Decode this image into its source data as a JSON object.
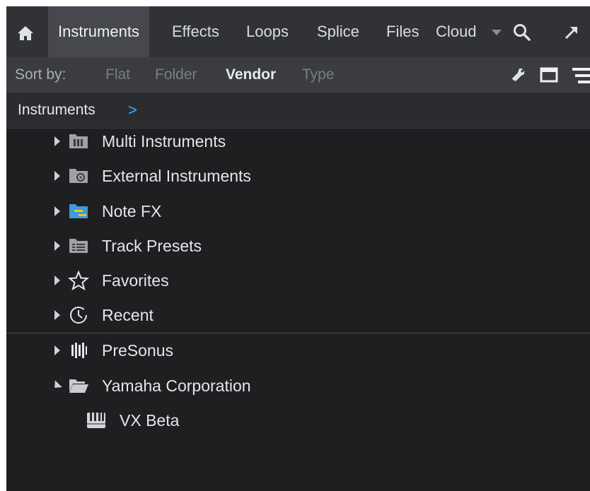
{
  "tabs": {
    "items": [
      {
        "label": "Instruments",
        "active": true
      },
      {
        "label": "Effects"
      },
      {
        "label": "Loops"
      },
      {
        "label": "Splice"
      },
      {
        "label": "Files"
      }
    ],
    "cloud_label": "Cloud"
  },
  "sort": {
    "label": "Sort by:",
    "options": [
      "Flat",
      "Folder",
      "Vendor",
      "Type"
    ],
    "selected": "Vendor"
  },
  "breadcrumb": {
    "label": "Instruments",
    "arrow": ">"
  },
  "tree": {
    "items": [
      {
        "label": "Multi Instruments",
        "icon": "multi-instruments-folder-icon"
      },
      {
        "label": "External Instruments",
        "icon": "external-instruments-folder-icon"
      },
      {
        "label": "Note FX",
        "icon": "note-fx-folder-icon"
      },
      {
        "label": "Track Presets",
        "icon": "track-presets-folder-icon"
      },
      {
        "label": "Favorites",
        "icon": "star-icon"
      },
      {
        "label": "Recent",
        "icon": "clock-icon"
      },
      {
        "label": "PreSonus",
        "icon": "presonus-logo-icon"
      },
      {
        "label": "Yamaha Corporation",
        "icon": "open-folder-icon",
        "expanded": true
      },
      {
        "label": "VX Beta",
        "icon": "keyboard-icon"
      }
    ]
  },
  "colors": {
    "accent": "#3fa8ff",
    "background": "#1f1f21",
    "tabbar": "#313236",
    "active_tab": "#46484d"
  }
}
